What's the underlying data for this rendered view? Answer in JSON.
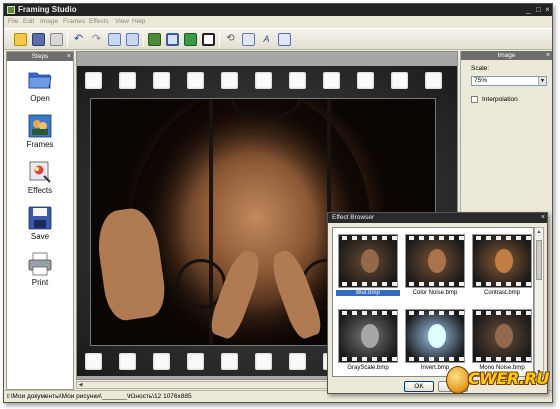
{
  "window": {
    "title": "Framing Studio"
  },
  "menu": [
    "File",
    "Edit",
    "Image",
    "Frames",
    "Effects",
    "View",
    "Help"
  ],
  "steps": {
    "header": "Steps",
    "items": [
      {
        "label": "Open",
        "icon": "folder-icon"
      },
      {
        "label": "Frames",
        "icon": "frames-icon"
      },
      {
        "label": "Effects",
        "icon": "effects-icon"
      },
      {
        "label": "Save",
        "icon": "floppy-disk-icon"
      },
      {
        "label": "Print",
        "icon": "printer-icon"
      }
    ]
  },
  "image_panel": {
    "header": "Image",
    "scale_label": "Scale:",
    "scale_value": "75%",
    "interpolation_label": "Interpolation",
    "interpolation_checked": false
  },
  "status": {
    "path": "I:\\Мои документы\\Мои рисунки\\_______\\Юность\\12  1076x885"
  },
  "effect_browser": {
    "title": "Effect Browser",
    "ok_label": "OK",
    "effects": [
      {
        "label": "Blur.bmp",
        "selected": true,
        "tone": "#6a4a34"
      },
      {
        "label": "Color Noise.bmp",
        "selected": false,
        "tone": "#7a5236"
      },
      {
        "label": "Contrast.bmp",
        "selected": false,
        "tone": "#8a5a30"
      },
      {
        "label": "GrayScale.bmp",
        "selected": false,
        "tone": "#777777"
      },
      {
        "label": "Invert.bmp",
        "selected": false,
        "tone": "#9fc6ef"
      },
      {
        "label": "Mono Noise.bmp",
        "selected": false,
        "tone": "#6a4c38"
      }
    ]
  },
  "watermark": {
    "text": "CWER.RU"
  }
}
